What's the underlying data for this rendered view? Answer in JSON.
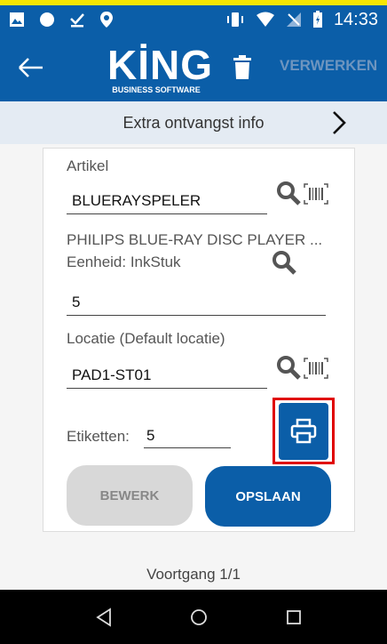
{
  "status_bar": {
    "time": "14:33",
    "left_icons": [
      "image-icon",
      "circle-icon",
      "download-check-icon",
      "location-icon"
    ],
    "right_icons": [
      "vibrate-icon",
      "wifi-icon",
      "no-signal-icon",
      "battery-icon"
    ]
  },
  "app_bar": {
    "logo_word": "KİNG",
    "logo_sub": "BUSINESS SOFTWARE",
    "process_label": "VERWERKEN"
  },
  "info_bar": {
    "label": "Extra ontvangst info"
  },
  "form": {
    "article_label": "Artikel",
    "article_value": "BLUERAYSPELER",
    "article_description": "PHILIPS BLUE-RAY DISC PLAYER ...",
    "unit_label": "Eenheid: InkStuk",
    "quantity_value": "5",
    "location_label": "Locatie (Default locatie)",
    "location_value": "PAD1-ST01",
    "labels_label": "Etiketten:",
    "labels_value": "5"
  },
  "buttons": {
    "edit_label": "BEWERK",
    "save_label": "OPSLAAN"
  },
  "footer": {
    "progress": "Voortgang 1/1"
  },
  "colors": {
    "brand_blue": "#0b5ea8",
    "highlight_red": "#e00000"
  }
}
